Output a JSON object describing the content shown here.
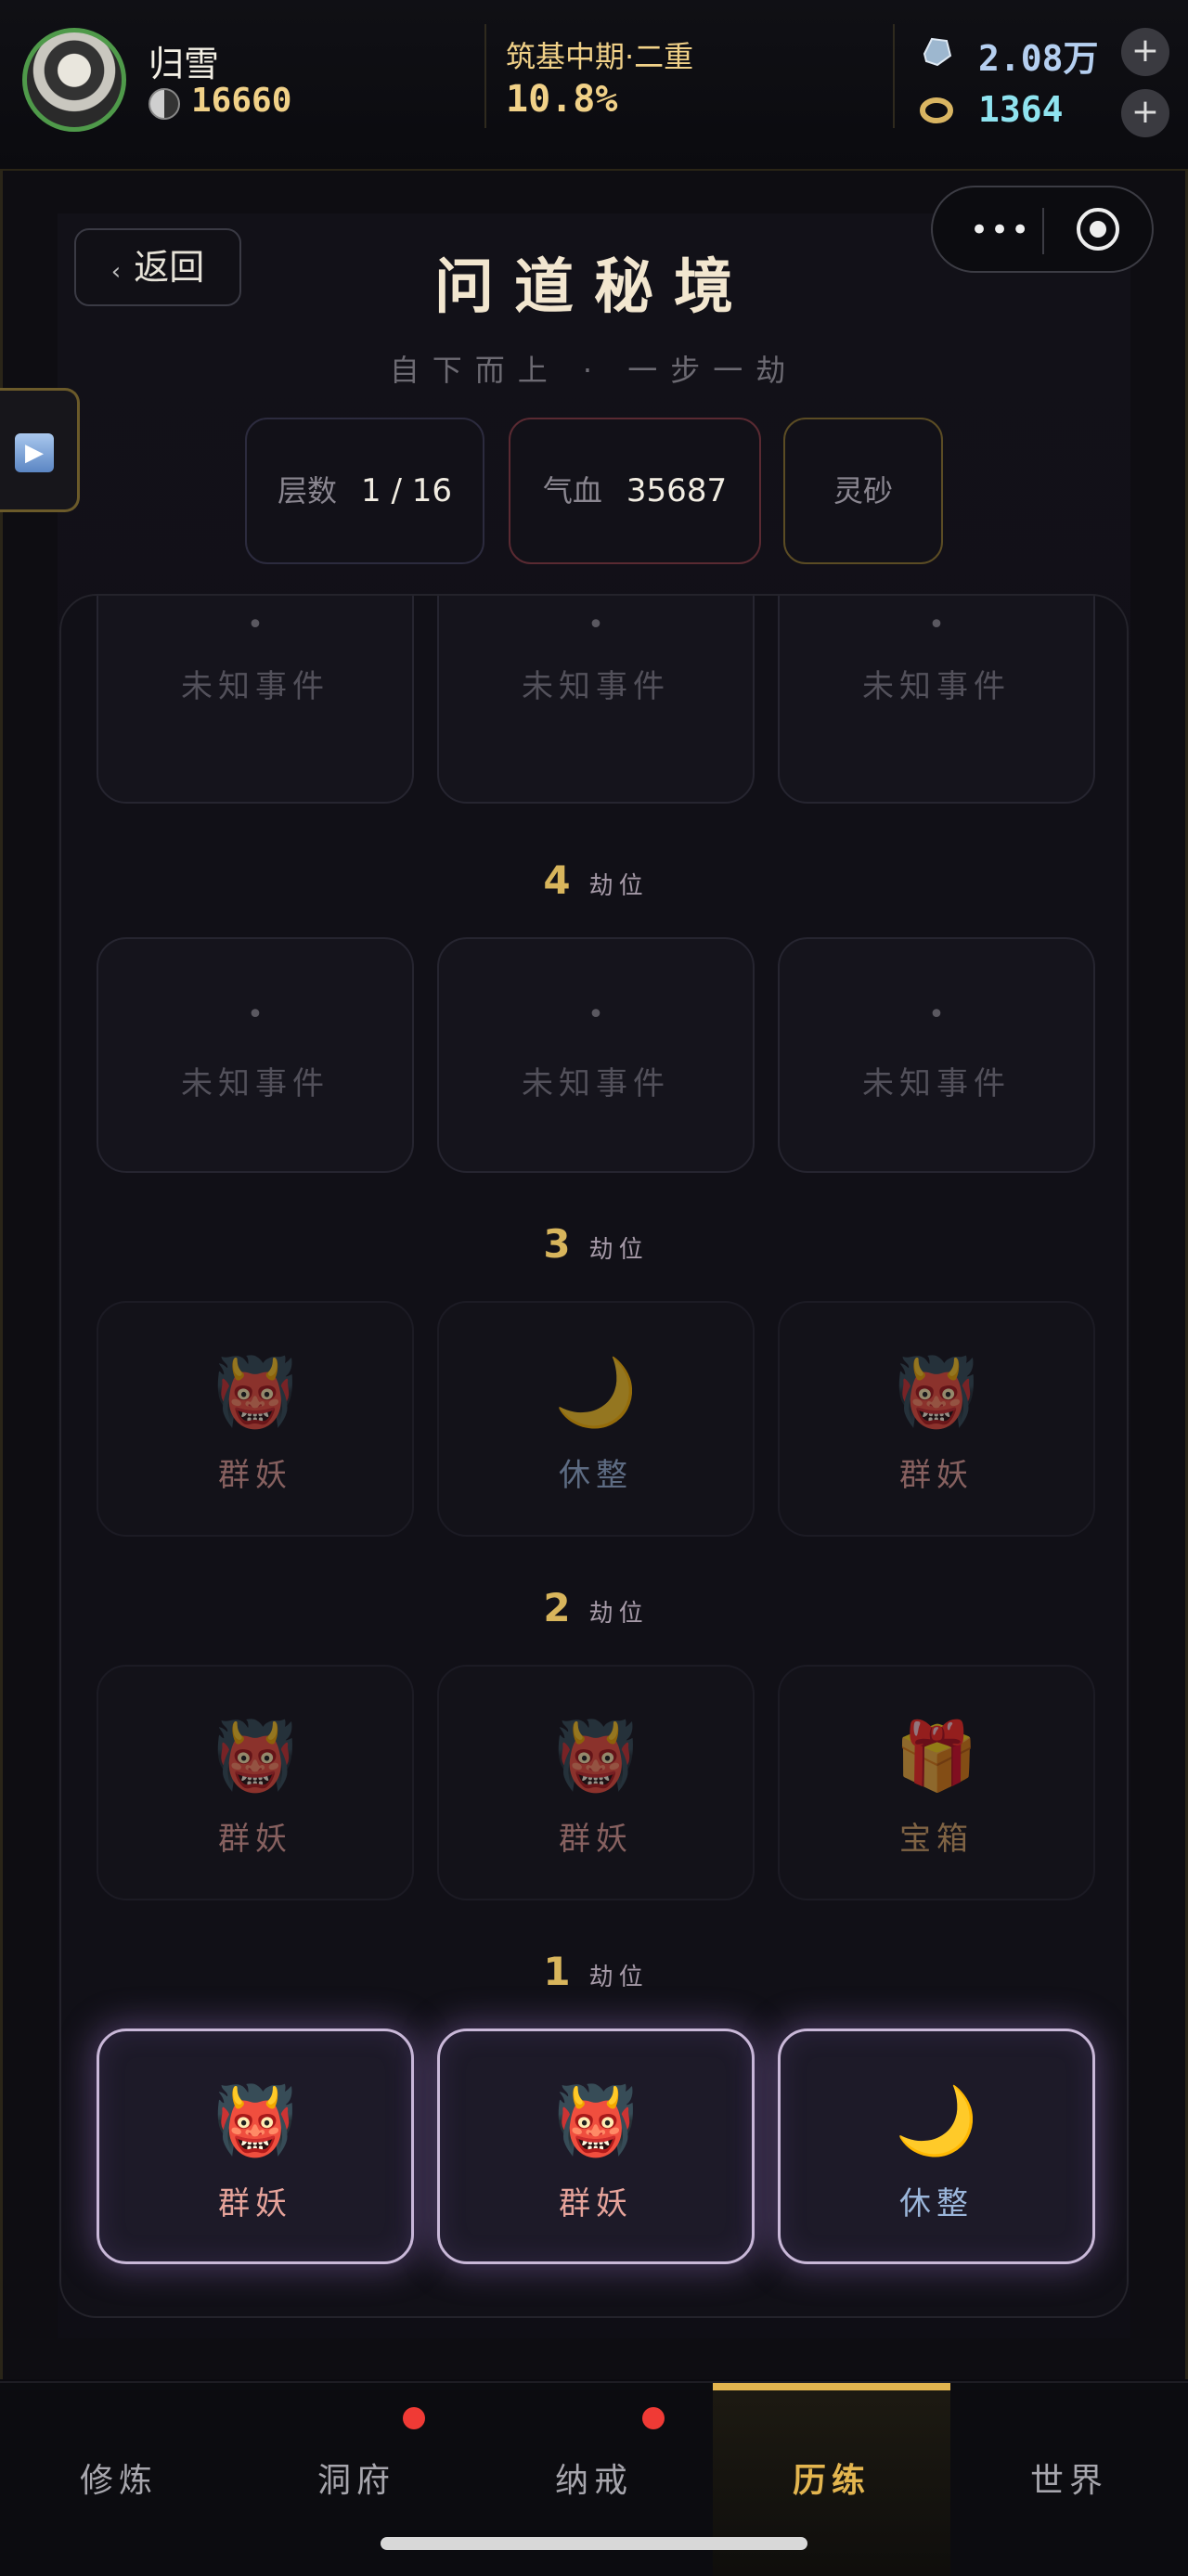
{
  "header": {
    "player_name": "归雪",
    "currency_value": "16660",
    "realm": "筑基中期·二重",
    "realm_progress": "10.8%",
    "spirit_stones": "2.08万",
    "rings": "1364",
    "plus": "+"
  },
  "nav": {
    "back_label": "返回",
    "back_chevron": "‹",
    "capsule_dots": "•••"
  },
  "page": {
    "title": "问道秘境",
    "subtitle": "自下而上 · 一步一劫"
  },
  "side_tab_icon": "▶",
  "stats": {
    "floors_label": "层数",
    "floors_value": "1 / 16",
    "hp_label": "气血",
    "hp_value": "35687",
    "sand_label": "灵砂"
  },
  "map": {
    "tier_suffix": "劫位",
    "unknown_dot": "•",
    "top_row": [
      {
        "label": "未知事件"
      },
      {
        "label": "未知事件"
      },
      {
        "label": "未知事件"
      }
    ],
    "tiers": [
      {
        "num": "4",
        "cells": [
          {
            "label": "未知事件"
          },
          {
            "label": "未知事件"
          },
          {
            "label": "未知事件"
          }
        ]
      },
      {
        "num": "3",
        "cells": [
          {
            "label": "群妖",
            "icon": "👹"
          },
          {
            "label": "休整",
            "icon": "🌙"
          },
          {
            "label": "群妖",
            "icon": "👹"
          }
        ]
      },
      {
        "num": "2",
        "cells": [
          {
            "label": "群妖",
            "icon": "👹"
          },
          {
            "label": "群妖",
            "icon": "👹"
          },
          {
            "label": "宝箱",
            "icon": "🎁"
          }
        ]
      },
      {
        "num": "1",
        "cells": [
          {
            "label": "群妖",
            "icon": "👹"
          },
          {
            "label": "群妖",
            "icon": "👹"
          },
          {
            "label": "休整",
            "icon": "🌙"
          }
        ]
      }
    ]
  },
  "bottom_nav": [
    {
      "label": "修炼"
    },
    {
      "label": "洞府"
    },
    {
      "label": "纳戒"
    },
    {
      "label": "历练"
    },
    {
      "label": "世界"
    }
  ],
  "colors": {
    "accent_gold": "#e3b54f",
    "alert_red": "#f03a35",
    "hp_border": "#5a2a32"
  }
}
